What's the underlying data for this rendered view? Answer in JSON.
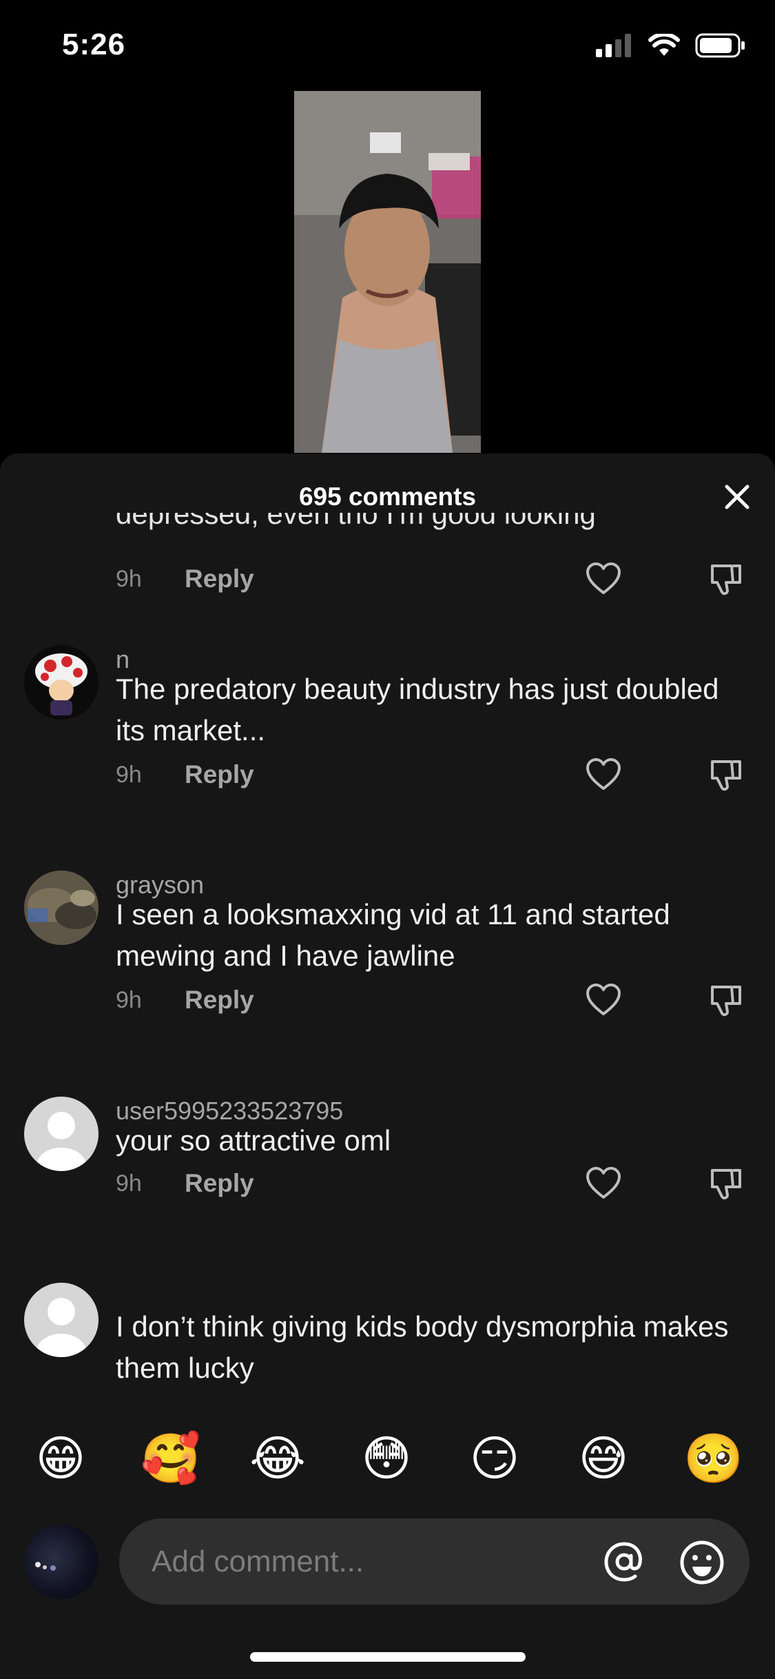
{
  "status_bar": {
    "time": "5:26",
    "icons": [
      "cellular-signal-icon",
      "wifi-icon",
      "battery-icon"
    ]
  },
  "video": {
    "description_icon": "video-thumbnail"
  },
  "sheet": {
    "title": "695 comments"
  },
  "clipped_comment": {
    "text": "depressed, even tho I'm good looking",
    "time": "9h",
    "reply_label": "Reply"
  },
  "comments": [
    {
      "user": "n",
      "text": "The predatory beauty industry has just doubled its market...",
      "time": "9h",
      "reply_label": "Reply"
    },
    {
      "user": "grayson",
      "text": "I seen a looksmaxxing vid at 11 and started mewing and I have jawline",
      "time": "9h",
      "reply_label": "Reply"
    },
    {
      "user": "user5995233523795",
      "text": "your so attractive oml",
      "time": "9h",
      "reply_label": "Reply"
    },
    {
      "user": "",
      "text": "I don’t think giving kids body dysmorphia makes them lucky"
    }
  ],
  "emoji_bar": [
    "😁",
    "🥰",
    "😂",
    "😳",
    "😏",
    "😅",
    "🥺"
  ],
  "composer": {
    "placeholder": "Add comment..."
  },
  "colors": {
    "sheet_bg": "#161616",
    "input_bg": "#2f2f2f",
    "muted_text": "#a6a6a6"
  }
}
